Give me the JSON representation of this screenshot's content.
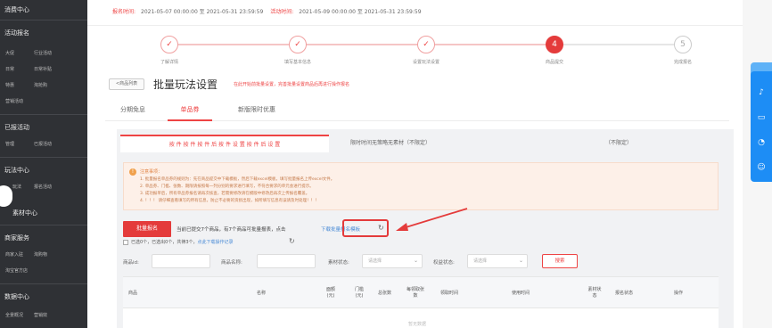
{
  "sidebar": {
    "sections": [
      {
        "label": "消费中心"
      },
      {
        "label": "活动报名"
      },
      {
        "label": "已报活动"
      },
      {
        "label": "玩法中心"
      },
      {
        "label": "素材中心"
      },
      {
        "label": "商家服务"
      },
      {
        "label": "数据中心"
      }
    ],
    "items": [
      "大促",
      "行业活动",
      "日常",
      "日常补贴",
      "特惠",
      "淘抢购",
      "营销活动",
      "管理",
      "已报活动",
      "玩法",
      "报名活动",
      "商家入驻",
      "淘购物",
      "淘宝官方店",
      "全景概况",
      "营销效"
    ]
  },
  "top_info": {
    "signup_time_label": "报名时间:",
    "signup_time": "2021-05-07 00:00:00 至 2021-05-31 23:59:59",
    "activity_time_label": "活动时间:",
    "activity_time": "2021-05-09 00:00:00 至 2021-05-31 23:59:59"
  },
  "steps": [
    {
      "label": "了解详情",
      "icon": "check-icon",
      "glyph": "✓",
      "state": "done"
    },
    {
      "label": "填写基本信息",
      "icon": "check-icon",
      "glyph": "✓",
      "state": "done"
    },
    {
      "label": "设置玩法设置",
      "icon": "check-icon",
      "glyph": "✓",
      "state": "done"
    },
    {
      "label": "商品提交",
      "icon": "step-number-icon",
      "glyph": "4",
      "state": "active"
    },
    {
      "label": "完成报名",
      "icon": "step-number-icon",
      "glyph": "5",
      "state": "pending"
    }
  ],
  "header": {
    "back_label": "<商品列表",
    "title": "批量玩法设置",
    "hint": "在此开始前批量设置，完善批量设置商品后再进行操作报名"
  },
  "tabs": [
    "分期免息",
    "单品券",
    "新版限时优惠"
  ],
  "subtabs": {
    "first": "按 件 按 件 按 件 后 按 件 设 置 按 件 后 设 置",
    "second": "限时时间无策略无素材（不限定）",
    "third": "（不限定）"
  },
  "notice": {
    "title": "注意事项：",
    "lines": [
      "1. 批量报名单品券的规则为：先在商品提交中下载模板，然后下载excel模板，填写批量报名上传excel文件。",
      "2. 单品券、门槛、张数、期限请按照每一列分别的要求进行填写，不符合要求的单元会进行提示。",
      "3. 成功报单后，所有单品券报名请再次核查，若需要修改请在模版中修改后再次上传报名覆盖。",
      "4. ！！！ 请仔细查看填写的所有信息，防止不必要的资损出现，如所填写信息有误请及时处理！！！"
    ]
  },
  "actions": {
    "batch_button": "批量报名",
    "status_prefix": "当前已提交7个商品，有7个商品可批量报表，点击",
    "template_link": "下载批量报名模板",
    "selected_text": "已选0个，已选出0个，共筛3个，",
    "batch_link": "点此下载操作记录"
  },
  "filters": {
    "item_id_label": "商品id:",
    "item_name_label": "商品名称:",
    "material_status_label": "素材状态:",
    "material_status_placeholder": "请选择",
    "rights_status_label": "权益状态:",
    "rights_status_placeholder": "请选择",
    "search_button": "搜索"
  },
  "table": {
    "columns": [
      "商品",
      "名称",
      "面额(元)",
      "门槛(元)",
      "总张数",
      "每领取张数",
      "领取时间",
      "使用时间",
      "素材状态",
      "报名状态",
      "操作"
    ],
    "empty_text": "暂无数据"
  },
  "float_panel": {
    "icons": [
      "bell-icon",
      "chat-icon",
      "clock-icon",
      "user-icon"
    ]
  },
  "colors": {
    "accent": "#e43b3b",
    "link": "#4a8bd6",
    "sidebar": "#2f3135",
    "float": "#1d8df5"
  }
}
